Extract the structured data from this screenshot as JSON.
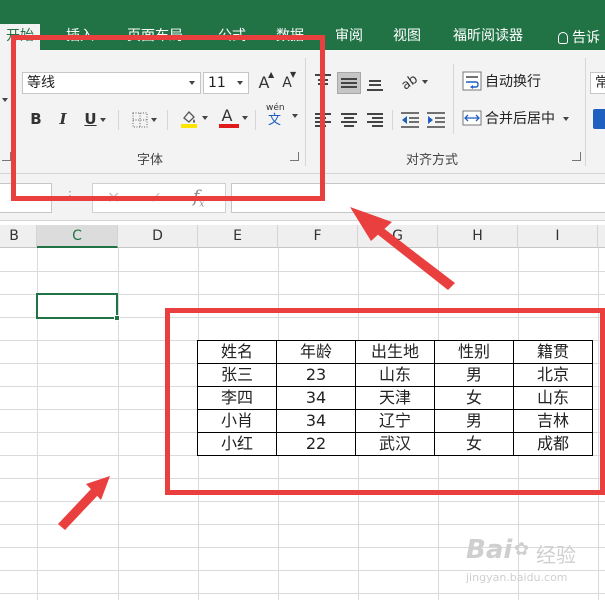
{
  "ribbon_tabs": [
    "开始",
    "插入",
    "页面布局",
    "公式",
    "数据",
    "审阅",
    "视图",
    "福昕阅读器"
  ],
  "tell_me": "告诉",
  "font_group": {
    "font_name": "等线",
    "font_size": "11",
    "increase_size": "A",
    "decrease_size": "A",
    "bold": "B",
    "italic": "I",
    "underline": "U",
    "font_color_letter": "A",
    "phonetic_top": "wén",
    "phonetic_bottom": "文",
    "label": "字体"
  },
  "alignment_group": {
    "wrap_text": "自动换行",
    "merge_center": "合并后居中",
    "label": "对齐方式"
  },
  "number_group": {
    "format_peek": "常"
  },
  "formula_bar": {
    "fx": "f"
  },
  "columns": [
    "B",
    "C",
    "D",
    "E",
    "F",
    "G",
    "H",
    "I"
  ],
  "active_column": "C",
  "table": {
    "headers": [
      "姓名",
      "年龄",
      "出生地",
      "性别",
      "籍贯"
    ],
    "rows": [
      [
        "张三",
        "23",
        "山东",
        "男",
        "北京"
      ],
      [
        "李四",
        "34",
        "天津",
        "女",
        "山东"
      ],
      [
        "小肖",
        "34",
        "辽宁",
        "男",
        "吉林"
      ],
      [
        "小红",
        "22",
        "武汉",
        "女",
        "成都"
      ]
    ]
  },
  "colors": {
    "excel_green": "#217346",
    "annotation_red": "#ea3f3f",
    "font_color_bar": "#e01b1b",
    "fill_color_bar": "#ffe600"
  },
  "watermark": {
    "brand": "Bai",
    "cn": "经验",
    "url": "jingyan.baidu.com"
  }
}
